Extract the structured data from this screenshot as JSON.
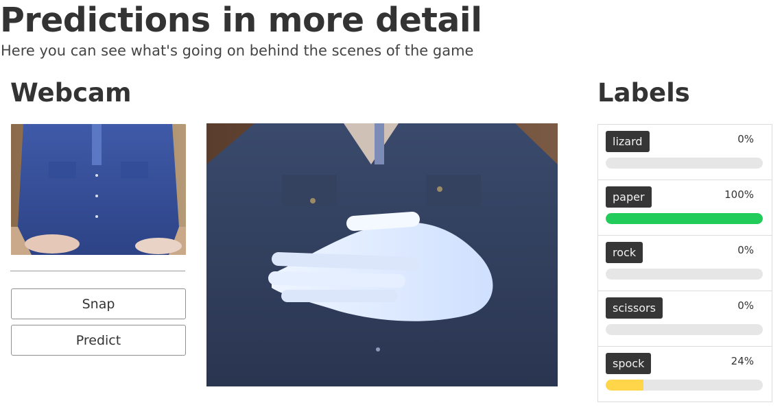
{
  "header": {
    "title": "Predictions in more detail",
    "subtitle": "Here you can see what's going on behind the scenes of the game"
  },
  "webcam": {
    "title": "Webcam",
    "snap_label": "Snap",
    "predict_label": "Predict"
  },
  "labels": {
    "title": "Labels",
    "items": [
      {
        "name": "lizard",
        "percent_text": "0%",
        "value": 0,
        "color": "#d9d9d9"
      },
      {
        "name": "paper",
        "percent_text": "100%",
        "value": 1.0,
        "color": "#22cc5a"
      },
      {
        "name": "rock",
        "percent_text": "0%",
        "value": 0,
        "color": "#d9d9d9"
      },
      {
        "name": "scissors",
        "percent_text": "0%",
        "value": 0,
        "color": "#d9d9d9"
      },
      {
        "name": "spock",
        "percent_text": "24%",
        "value": 0.24,
        "color": "#ffd54a"
      }
    ]
  }
}
